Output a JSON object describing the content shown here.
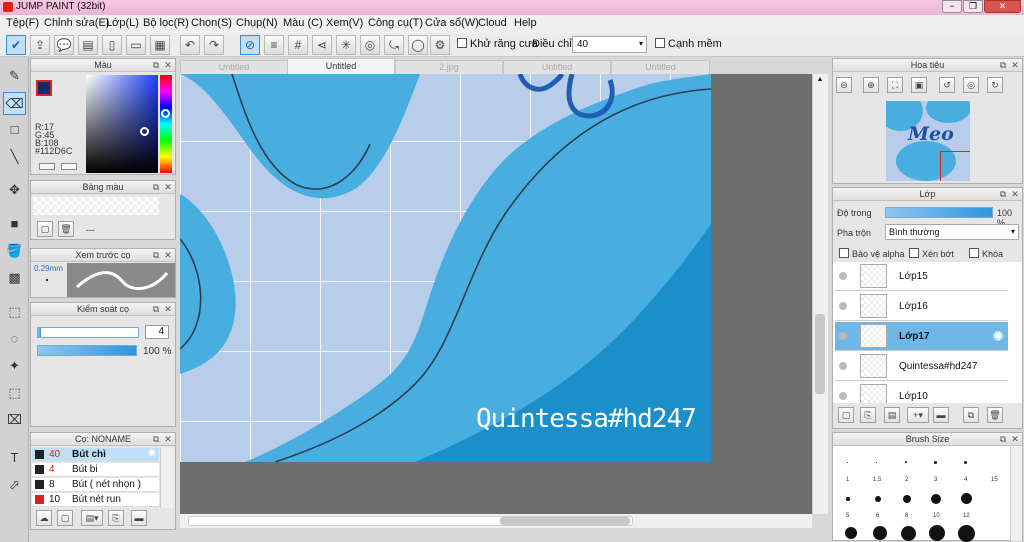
{
  "window": {
    "title": "JUMP PAINT (32bit)",
    "minimize": "−",
    "restore": "❐",
    "close": "✕"
  },
  "menu": [
    "Tệp(F)",
    "Chỉnh sửa(E)",
    "Lớp(L)",
    "Bộ lọc(R)",
    "Chọn(S)",
    "Chụp(N)",
    "Màu (C)",
    "Xem(V)",
    "Công cụ(T)",
    "Cửa sổ(W)",
    "Cloud",
    "Help"
  ],
  "toolbar": {
    "antialias_label": "Khử răng cưa",
    "adjust_label": "Điều chỉnh",
    "adjust_value": "40",
    "edge_label": "Cạnh mềm"
  },
  "color_panel": {
    "title": "Màu",
    "r": "R:17",
    "g": "G:45",
    "b": "B:108",
    "hex": "#112D6C",
    "primary_color": "#112d6c"
  },
  "swatch_panel": {
    "title": "Bảng màu",
    "value": "---"
  },
  "preview_panel": {
    "title": "Xem trước cọ",
    "size": "0.29mm"
  },
  "control_panel": {
    "title": "Kiểm soát cọ",
    "size_value": "4",
    "opacity": 100,
    "opacity_label": "100 %"
  },
  "brush_panel": {
    "title": "Cọ: NONAME",
    "brushes": [
      {
        "size": "40",
        "name": "Bút chì",
        "color": "#111111"
      },
      {
        "size": "4",
        "name": "Bút bi",
        "color": "#111111"
      },
      {
        "size": "8",
        "name": "Bút ( nét nhọn )",
        "color": "#111111"
      },
      {
        "size": "10",
        "name": "Bút nét run",
        "color": "#e02020"
      }
    ]
  },
  "tabs": [
    "Untitled",
    "Untitled",
    "2.jpg",
    "Untitled",
    "Untitled"
  ],
  "canvas": {
    "watermark": "Quintessa#hd247"
  },
  "navigator": {
    "title": "Hoa tiêu",
    "thumb_text": "Meo"
  },
  "layer_panel": {
    "title": "Lớp",
    "opacity_label": "Độ trong",
    "opacity": 100,
    "opacity_value": "100 %",
    "blend_label": "Pha trộn",
    "blend_value": "Bình thường",
    "protect_alpha": "Bảo vệ alpha",
    "clipping": "Xén bớt",
    "lock": "Khóa",
    "layers": [
      "Lớp15",
      "Lớp16",
      "Lớp17",
      "Quintessa#hd247",
      "Lớp10"
    ]
  },
  "brushsize_panel": {
    "title": "Brush Size",
    "labels": [
      "1",
      "1.5",
      "2",
      "3",
      "4",
      "5",
      "6",
      "8",
      "10",
      "12",
      "15"
    ]
  },
  "colors": {
    "accent": "#3a8fd4",
    "canvas_bg": "#b8cde9",
    "blob": "#48aee0",
    "dark_blob": "#1a8fc9"
  }
}
